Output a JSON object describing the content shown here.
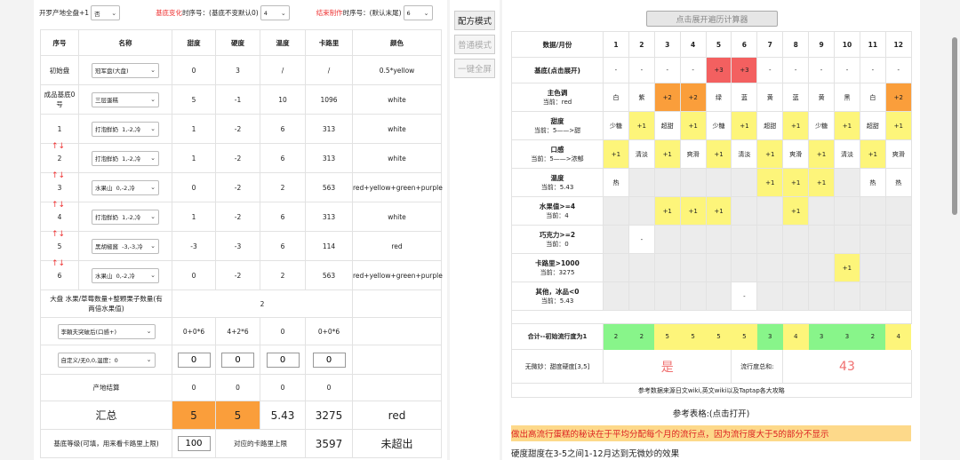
{
  "top": {
    "luo_label": "开罗产地全盘+1",
    "luo_value": "否",
    "change_red": "基底变化",
    "change_label": "时序号：(基底不变默认0)",
    "change_value": "4",
    "end_red": "结束制作",
    "end_label": "时序号：(默认末尾)",
    "end_value": "6"
  },
  "left": {
    "headers": [
      "序号",
      "名称",
      "甜度",
      "硬度",
      "温度",
      "卡路里",
      "颜色"
    ],
    "rows": [
      {
        "no": "初始盘",
        "name": "冠军盘(大盘)",
        "sweet": "0",
        "hard": "3",
        "temp": "/",
        "cal": "/",
        "color": "0.5*yellow"
      },
      {
        "no": "成品基底0号",
        "name": "三层蛋糕",
        "sweet": "5",
        "hard": "-1",
        "temp": "10",
        "cal": "1096",
        "color": "white"
      },
      {
        "no": "1",
        "name": "打泡鲜奶  1,-2,冷",
        "sweet": "1",
        "hard": "-2",
        "temp": "6",
        "cal": "313",
        "color": "white"
      },
      {
        "no": "2",
        "name": "打泡鲜奶  1,-2,冷",
        "sweet": "1",
        "hard": "-2",
        "temp": "6",
        "cal": "313",
        "color": "white"
      },
      {
        "no": "3",
        "name": "水果山  0,-2,冷",
        "sweet": "0",
        "hard": "-2",
        "temp": "2",
        "cal": "563",
        "color": "red+yellow+green+purple"
      },
      {
        "no": "4",
        "name": "打泡鲜奶  1,-2,冷",
        "sweet": "1",
        "hard": "-2",
        "temp": "6",
        "cal": "313",
        "color": "white"
      },
      {
        "no": "5",
        "name": "黑胡椒酱  -3,-3,冷",
        "sweet": "-3",
        "hard": "-3",
        "temp": "6",
        "cal": "114",
        "color": "red"
      },
      {
        "no": "6",
        "name": "水果山  0,-2,冷",
        "sweet": "0",
        "hard": "-2",
        "temp": "2",
        "cal": "563",
        "color": "red+yellow+green+purple"
      }
    ],
    "arrows": "↑↓",
    "fruit_label": "大盘 水果/草莓数量+整颗栗子数量(有两倍水果值)",
    "fruit_value": "2",
    "li_select": "李頼夫突破后(口感+)",
    "li_vals": [
      "0+0*6",
      "4+2*6",
      "0",
      "0+0*6"
    ],
    "custom_select": "自定义/无0,0,温度：0",
    "custom_vals": [
      "0",
      "0",
      "0",
      "0"
    ],
    "origin_label": "产地结算",
    "origin_vals": [
      "0",
      "0",
      "0",
      "0"
    ],
    "sum_label": "汇总",
    "sum_vals": [
      "5",
      "5",
      "5.43",
      "3275",
      "red"
    ],
    "level_label": "基底等级(可填，用来看卡路里上限)",
    "level_value": "100",
    "cap_label": "对应的卡路里上限",
    "cap_value": "3597",
    "cap_status": "未超出"
  },
  "mid": {
    "recipe_mode": "配方模式",
    "normal_mode": "普通模式",
    "fullscreen": "一键全屏"
  },
  "right": {
    "expand_button": "点击展开遍历计算器",
    "header": "数据/月份",
    "months": [
      "1",
      "2",
      "3",
      "4",
      "5",
      "6",
      "7",
      "8",
      "9",
      "10",
      "11",
      "12"
    ],
    "rows": [
      {
        "title": "基底(点击展开)",
        "sub": "",
        "cells": [
          "-",
          "-",
          "-",
          "-",
          "+3",
          "+3",
          "-",
          "-",
          "-",
          "-",
          "-",
          "-"
        ],
        "cls": [
          "",
          "",
          "",
          "",
          "rd",
          "rd",
          "",
          "",
          "",
          "",
          "",
          ""
        ]
      },
      {
        "title": "主色调",
        "sub": "当前：red",
        "cells": [
          "白",
          "紫",
          "+2",
          "+2",
          "绿",
          "蓝",
          "黄",
          "蓝",
          "黄",
          "黑",
          "白",
          "+2"
        ],
        "cls": [
          "",
          "",
          "o",
          "o",
          "",
          "",
          "",
          "",
          "",
          "",
          "",
          "o"
        ]
      },
      {
        "title": "甜度",
        "sub": "当前：5——>甜",
        "cells": [
          "少糖",
          "+1",
          "超甜",
          "+1",
          "少糖",
          "+1",
          "超甜",
          "+1",
          "少糖",
          "+1",
          "超甜",
          "+1"
        ],
        "cls": [
          "",
          "y",
          "",
          "y",
          "",
          "y",
          "",
          "y",
          "",
          "y",
          "",
          "y"
        ]
      },
      {
        "title": "口感",
        "sub": "当前：5——>浓郁",
        "cells": [
          "+1",
          "清淡",
          "+1",
          "爽滑",
          "+1",
          "清淡",
          "+1",
          "爽滑",
          "+1",
          "清淡",
          "+1",
          "爽滑"
        ],
        "cls": [
          "y",
          "",
          "y",
          "",
          "y",
          "",
          "y",
          "",
          "y",
          "",
          "y",
          ""
        ]
      },
      {
        "title": "温度",
        "sub": "当前：5.43",
        "cells": [
          "热",
          "",
          "",
          "",
          "",
          "",
          "+1",
          "+1",
          "+1",
          "",
          "热",
          "热"
        ],
        "cls": [
          "",
          "gr",
          "gr",
          "gr",
          "gr",
          "gr",
          "y",
          "y",
          "y",
          "gr",
          "",
          ""
        ]
      },
      {
        "title": "水果值>=4",
        "sub": "当前：4",
        "cells": [
          "",
          "",
          "+1",
          "+1",
          "+1",
          "",
          "",
          "+1",
          "",
          "",
          "",
          ""
        ],
        "cls": [
          "gr",
          "gr",
          "y",
          "y",
          "y",
          "gr",
          "gr",
          "y",
          "gr",
          "gr",
          "gr",
          "gr"
        ]
      },
      {
        "title": "巧克力>=2",
        "sub": "当前：0",
        "cells": [
          "",
          "-",
          "",
          "",
          "",
          "",
          "",
          "",
          "",
          "",
          "",
          ""
        ],
        "cls": [
          "gr",
          "",
          "gr",
          "gr",
          "gr",
          "gr",
          "gr",
          "gr",
          "gr",
          "gr",
          "gr",
          "gr"
        ]
      },
      {
        "title": "卡路里>1000",
        "sub": "当前：3275",
        "cells": [
          "",
          "",
          "",
          "",
          "",
          "",
          "",
          "",
          "",
          "+1",
          "",
          ""
        ],
        "cls": [
          "gr",
          "gr",
          "gr",
          "gr",
          "gr",
          "gr",
          "gr",
          "gr",
          "gr",
          "y",
          "gr",
          "gr"
        ]
      },
      {
        "title": "其他，冰品<0",
        "sub": "当前：5.43",
        "cells": [
          "",
          "",
          "",
          "",
          "",
          "-",
          "",
          "",
          "",
          "",
          "",
          ""
        ],
        "cls": [
          "gr",
          "gr",
          "gr",
          "gr",
          "gr",
          "",
          "gr",
          "gr",
          "gr",
          "gr",
          "gr",
          "gr"
        ]
      }
    ],
    "total_label": "合计--初始流行度为1",
    "totals": [
      "2",
      "2",
      "5",
      "5",
      "5",
      "5",
      "3",
      "4",
      "3",
      "3",
      "2",
      "4"
    ],
    "total_cls": [
      "g",
      "g",
      "y",
      "y",
      "y",
      "y",
      "g",
      "y",
      "g",
      "g",
      "g",
      "y"
    ],
    "subtle_label": "无微妙：甜度硬度[3,5]",
    "subtle_value": "是",
    "pop_label": "流行度总和:",
    "pop_value": "43",
    "source": "参考数据来源日文wiki,英文wiki以及Taptap各大攻略",
    "ref_table": "参考表格:(点击打开)",
    "tip": "做出高流行蛋糕的秘诀在于平均分配每个月的流行点，因为流行度大于5的部分不显示",
    "note": "硬度甜度在3-5之间1-12月达到无微妙的效果"
  }
}
